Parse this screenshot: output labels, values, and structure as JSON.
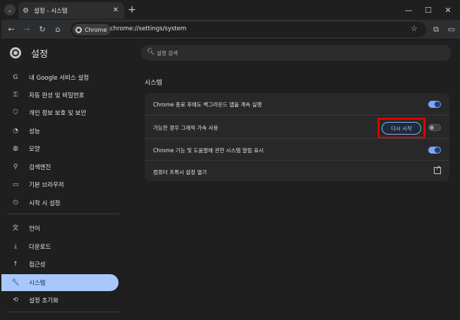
{
  "window": {
    "tab_title": "설정 - 시스템",
    "tab_icon": "gear-icon",
    "new_tab_icon": "plus-icon",
    "controls": [
      "minimize-icon",
      "maximize-icon",
      "close-icon"
    ]
  },
  "toolbar": {
    "chip_label": "Chrome",
    "url": "chrome://settings/system"
  },
  "header": {
    "title": "설정",
    "search_placeholder": "설정 검색"
  },
  "sidebar": {
    "items": [
      {
        "label": "내 Google 서비스 설정",
        "icon": "google-icon"
      },
      {
        "label": "자동 완성 및 비밀번호",
        "icon": "key-icon"
      },
      {
        "label": "개인 정보 보호 및 보안",
        "icon": "shield-icon"
      },
      {
        "label": "성능",
        "icon": "speedometer-icon"
      },
      {
        "label": "모양",
        "icon": "palette-icon"
      },
      {
        "label": "검색엔진",
        "icon": "search-icon"
      },
      {
        "label": "기본 브라우저",
        "icon": "browser-icon"
      },
      {
        "label": "시작 시 설정",
        "icon": "power-icon"
      },
      {
        "label": "언어",
        "icon": "translate-icon"
      },
      {
        "label": "다운로드",
        "icon": "download-icon"
      },
      {
        "label": "접근성",
        "icon": "accessibility-icon"
      },
      {
        "label": "시스템",
        "icon": "wrench-icon",
        "active": true
      },
      {
        "label": "설정 초기화",
        "icon": "reset-icon"
      }
    ]
  },
  "main": {
    "section_title": "시스템",
    "rows": [
      {
        "label": "Chrome 종료 후에도 백그라운드 앱을 계속 실행",
        "control": "toggle",
        "state": "on"
      },
      {
        "label": "가능한 경우 그래픽 가속 사용",
        "control": "toggle",
        "state": "off",
        "button_label": "다시 시작"
      },
      {
        "label": "Chrome 기능 및 도움말에 관한 시스템 알림 표시",
        "control": "toggle",
        "state": "on"
      },
      {
        "label": "컴퓨터 프록시 설정 열기",
        "control": "external-link"
      }
    ]
  },
  "colors": {
    "accent": "#a8c7fa",
    "highlight_box": "#e00000",
    "toggle_on": "#7ca6f7"
  }
}
